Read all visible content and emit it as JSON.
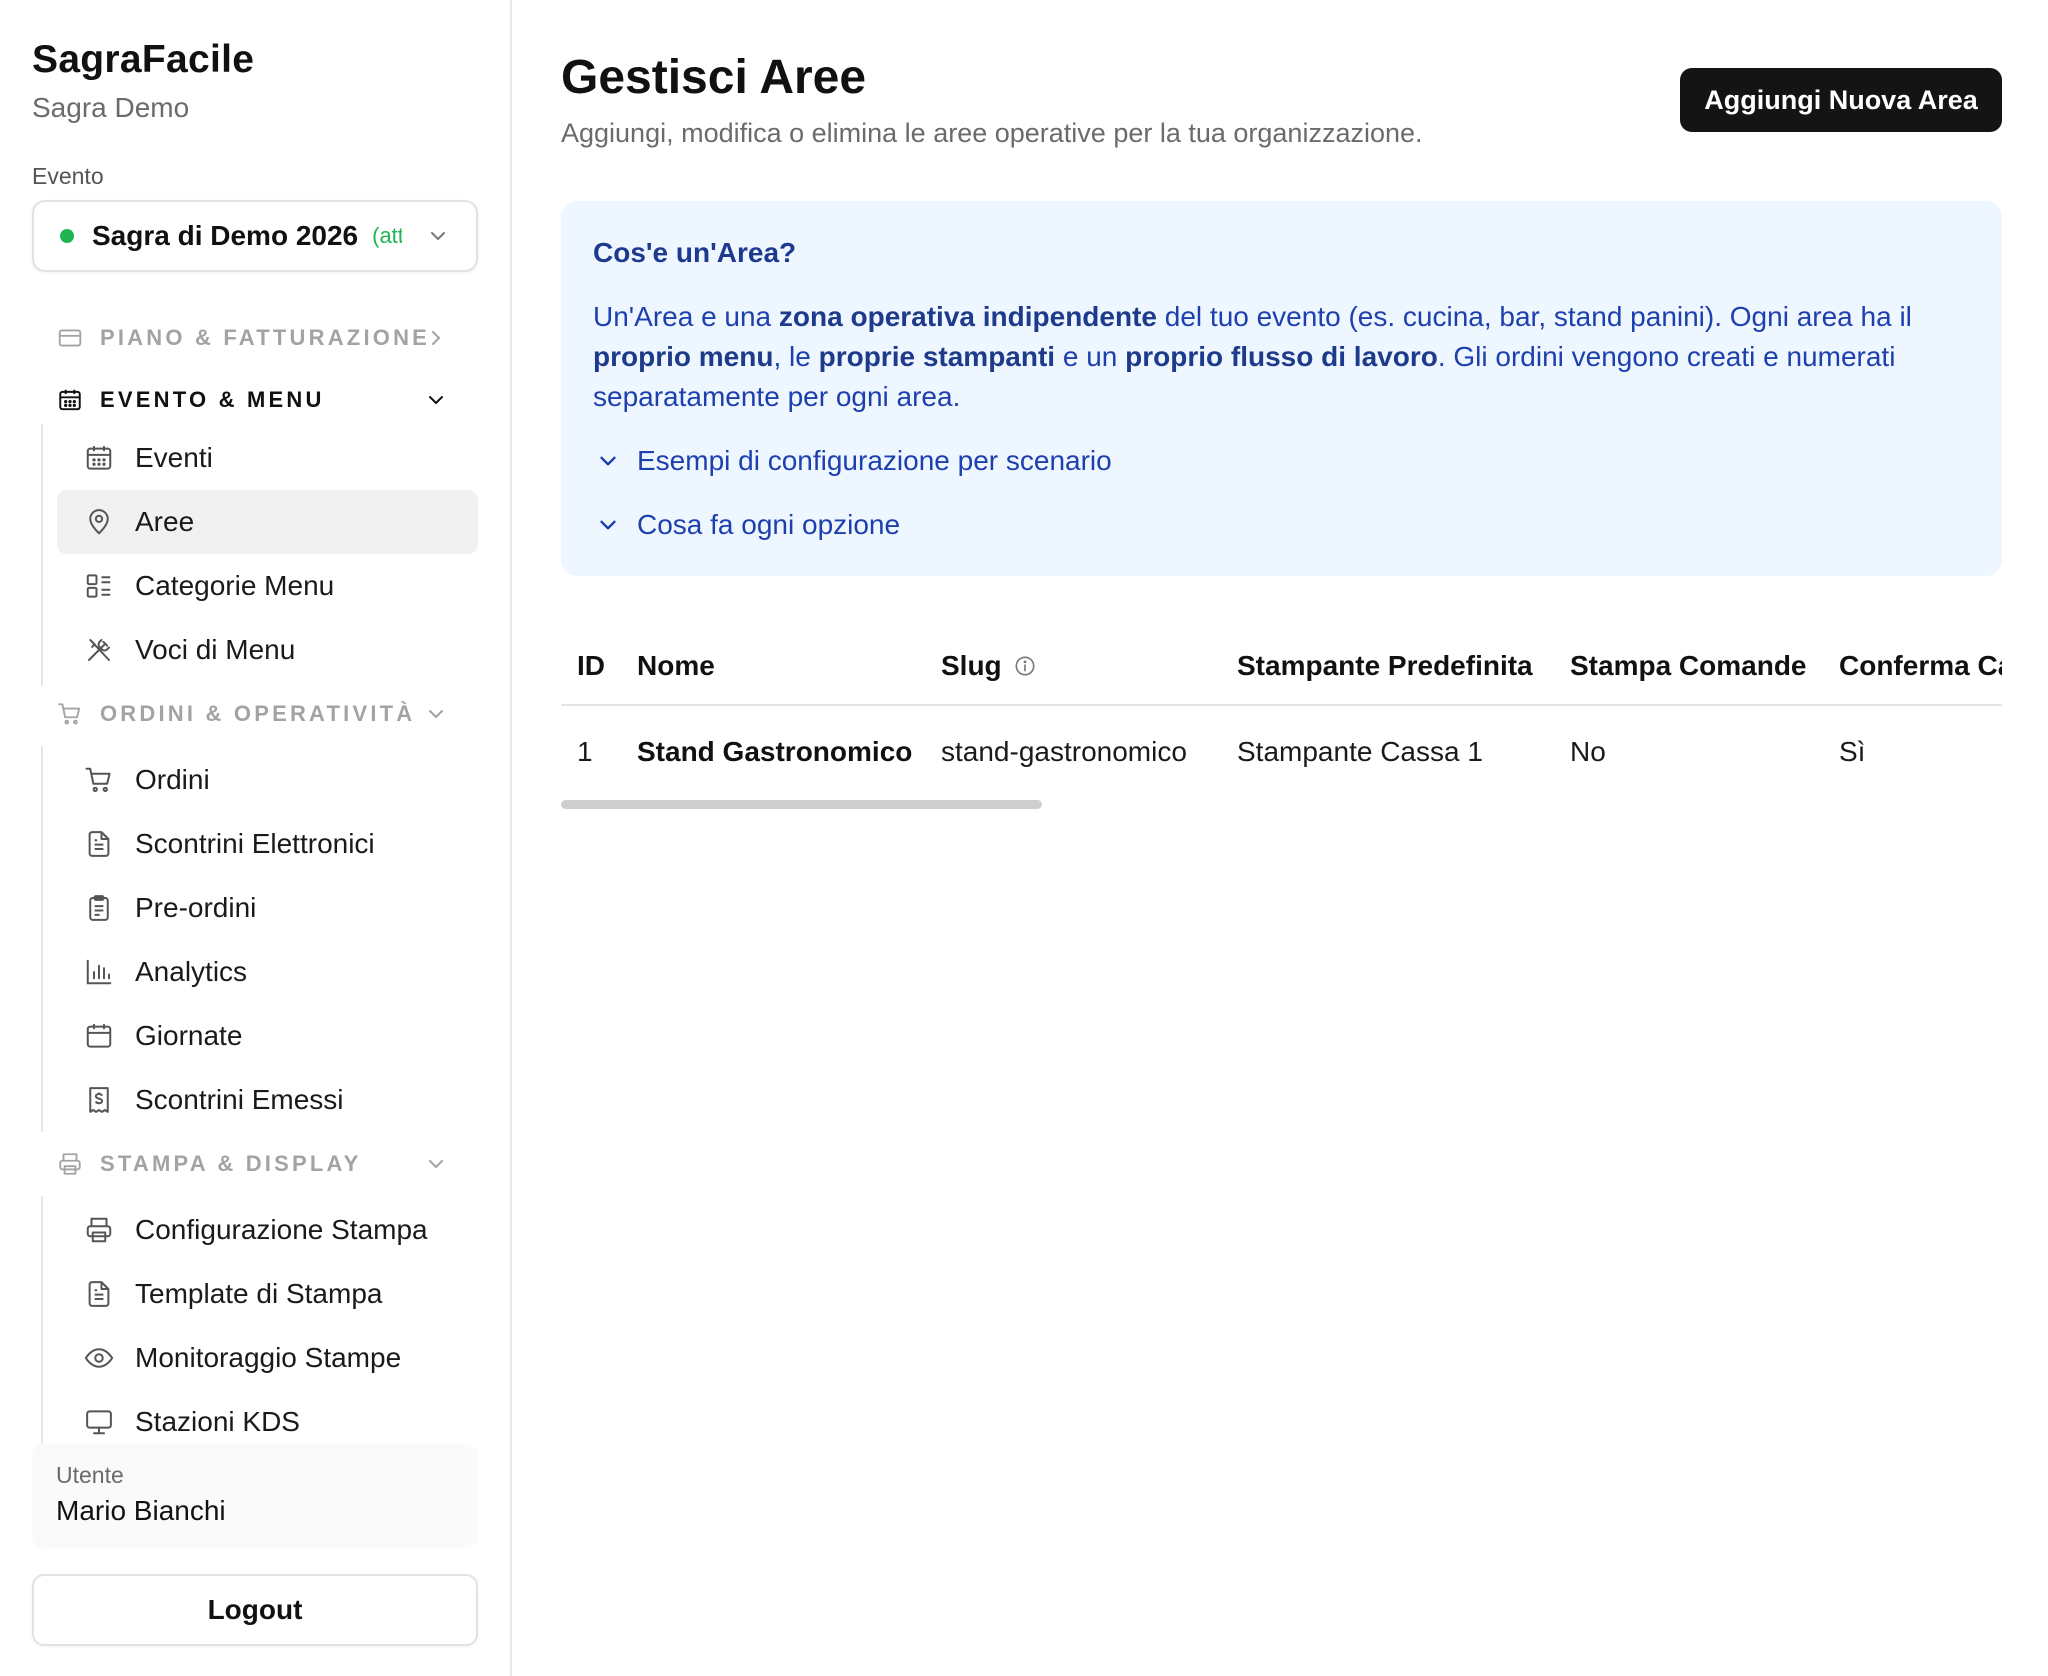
{
  "app": {
    "name": "SagraFacile",
    "organization": "Sagra Demo"
  },
  "event_selector": {
    "label": "Evento",
    "value": "Sagra di Demo 2026",
    "status": "(attivo)",
    "status_color": "#1fb552"
  },
  "sidebar": {
    "sections": [
      {
        "label": "PIANO & FATTURAZIONE",
        "icon": "credit-card-icon",
        "state": "collapsed-link",
        "items": []
      },
      {
        "label": "EVENTO & MENU",
        "icon": "calendar-icon",
        "state": "expanded",
        "items": [
          {
            "label": "Eventi",
            "icon": "calendar-grid-icon"
          },
          {
            "label": "Aree",
            "icon": "map-pin-icon",
            "selected": true
          },
          {
            "label": "Categorie Menu",
            "icon": "list-grid-icon"
          },
          {
            "label": "Voci di Menu",
            "icon": "utensils-crossed-icon"
          }
        ]
      },
      {
        "label": "ORDINI & OPERATIVITÀ",
        "icon": "cart-icon",
        "state": "expanded",
        "items": [
          {
            "label": "Ordini",
            "icon": "cart-icon"
          },
          {
            "label": "Scontrini Elettronici",
            "icon": "file-text-icon"
          },
          {
            "label": "Pre-ordini",
            "icon": "clipboard-list-icon"
          },
          {
            "label": "Analytics",
            "icon": "bar-chart-icon"
          },
          {
            "label": "Giornate",
            "icon": "calendar-icon"
          },
          {
            "label": "Scontrini Emessi",
            "icon": "receipt-icon"
          }
        ]
      },
      {
        "label": "STAMPA & DISPLAY",
        "icon": "printer-icon",
        "state": "expanded",
        "items": [
          {
            "label": "Configurazione Stampa",
            "icon": "printer-icon"
          },
          {
            "label": "Template di Stampa",
            "icon": "file-text-icon"
          },
          {
            "label": "Monitoraggio Stampe",
            "icon": "eye-icon"
          },
          {
            "label": "Stazioni KDS",
            "icon": "monitor-icon"
          }
        ]
      }
    ]
  },
  "user": {
    "label": "Utente",
    "name": "Mario Bianchi"
  },
  "logout_label": "Logout",
  "page": {
    "title": "Gestisci Aree",
    "subtitle": "Aggiungi, modifica o elimina le aree operative per la tua organizzazione.",
    "add_button": "Aggiungi Nuova Area"
  },
  "info": {
    "title": "Cos'e un'Area?",
    "body": {
      "p1": "Un'Area e una ",
      "b1": "zona operativa indipendente",
      "p2": " del tuo evento (es. cucina, bar, stand panini). Ogni area ha il ",
      "b2": "proprio menu",
      "p3": ", le ",
      "b3": "proprie stampanti",
      "p4": " e un ",
      "b4": "proprio flusso di lavoro",
      "p5": ". Gli ordini vengono creati e numerati separatamente per ogni area."
    },
    "toggles": [
      "Esempi di configurazione per scenario",
      "Cosa fa ogni opzione"
    ]
  },
  "table": {
    "columns": [
      "ID",
      "Nome",
      "Slug",
      "Stampante Predefinita",
      "Stampa Comande",
      "Conferma Cassa"
    ],
    "rows": [
      [
        "1",
        "Stand Gastronomico",
        "stand-gastronomico",
        "Stampante Cassa 1",
        "No",
        "Sì"
      ]
    ]
  },
  "colors": {
    "accent_dark": "#141414",
    "info_bg": "#eef6ff",
    "info_text": "#1e40af",
    "active_dot": "#1fb552"
  }
}
